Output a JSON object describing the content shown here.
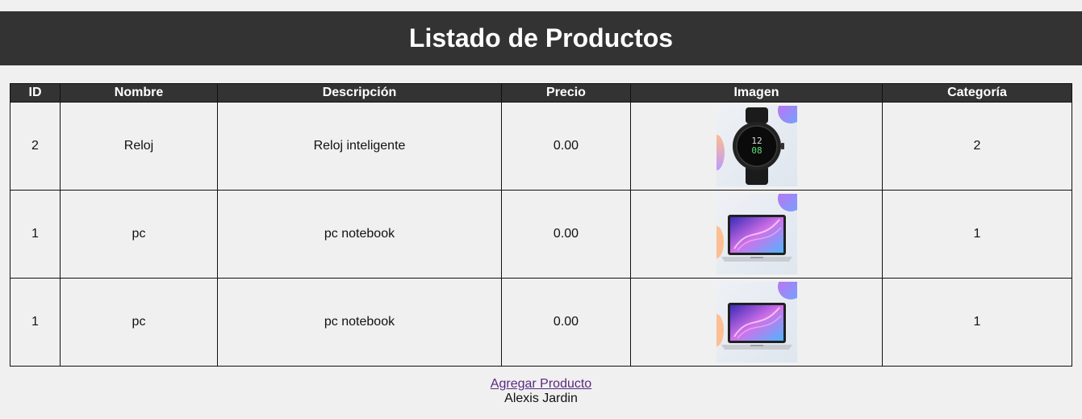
{
  "page": {
    "title": "Listado de Productos"
  },
  "table": {
    "headers": [
      "ID",
      "Nombre",
      "Descripción",
      "Precio",
      "Imagen",
      "Categoría"
    ],
    "rows": [
      {
        "id": "2",
        "nombre": "Reloj",
        "descripcion": "Reloj inteligente",
        "precio": "0.00",
        "imagen": "smartwatch-image",
        "categoria": "2"
      },
      {
        "id": "1",
        "nombre": "pc",
        "descripcion": "pc notebook",
        "precio": "0.00",
        "imagen": "laptop-image",
        "categoria": "1"
      },
      {
        "id": "1",
        "nombre": "pc",
        "descripcion": "pc notebook",
        "precio": "0.00",
        "imagen": "laptop-image",
        "categoria": "1"
      }
    ]
  },
  "watch_display": {
    "hour": "12",
    "minute": "08"
  },
  "footer": {
    "add_link": "Agregar Producto",
    "author": "Alexis Jardin"
  },
  "colors": {
    "header_bg": "#333333",
    "page_bg": "#f0f0f0",
    "link": "#5a2a82"
  }
}
